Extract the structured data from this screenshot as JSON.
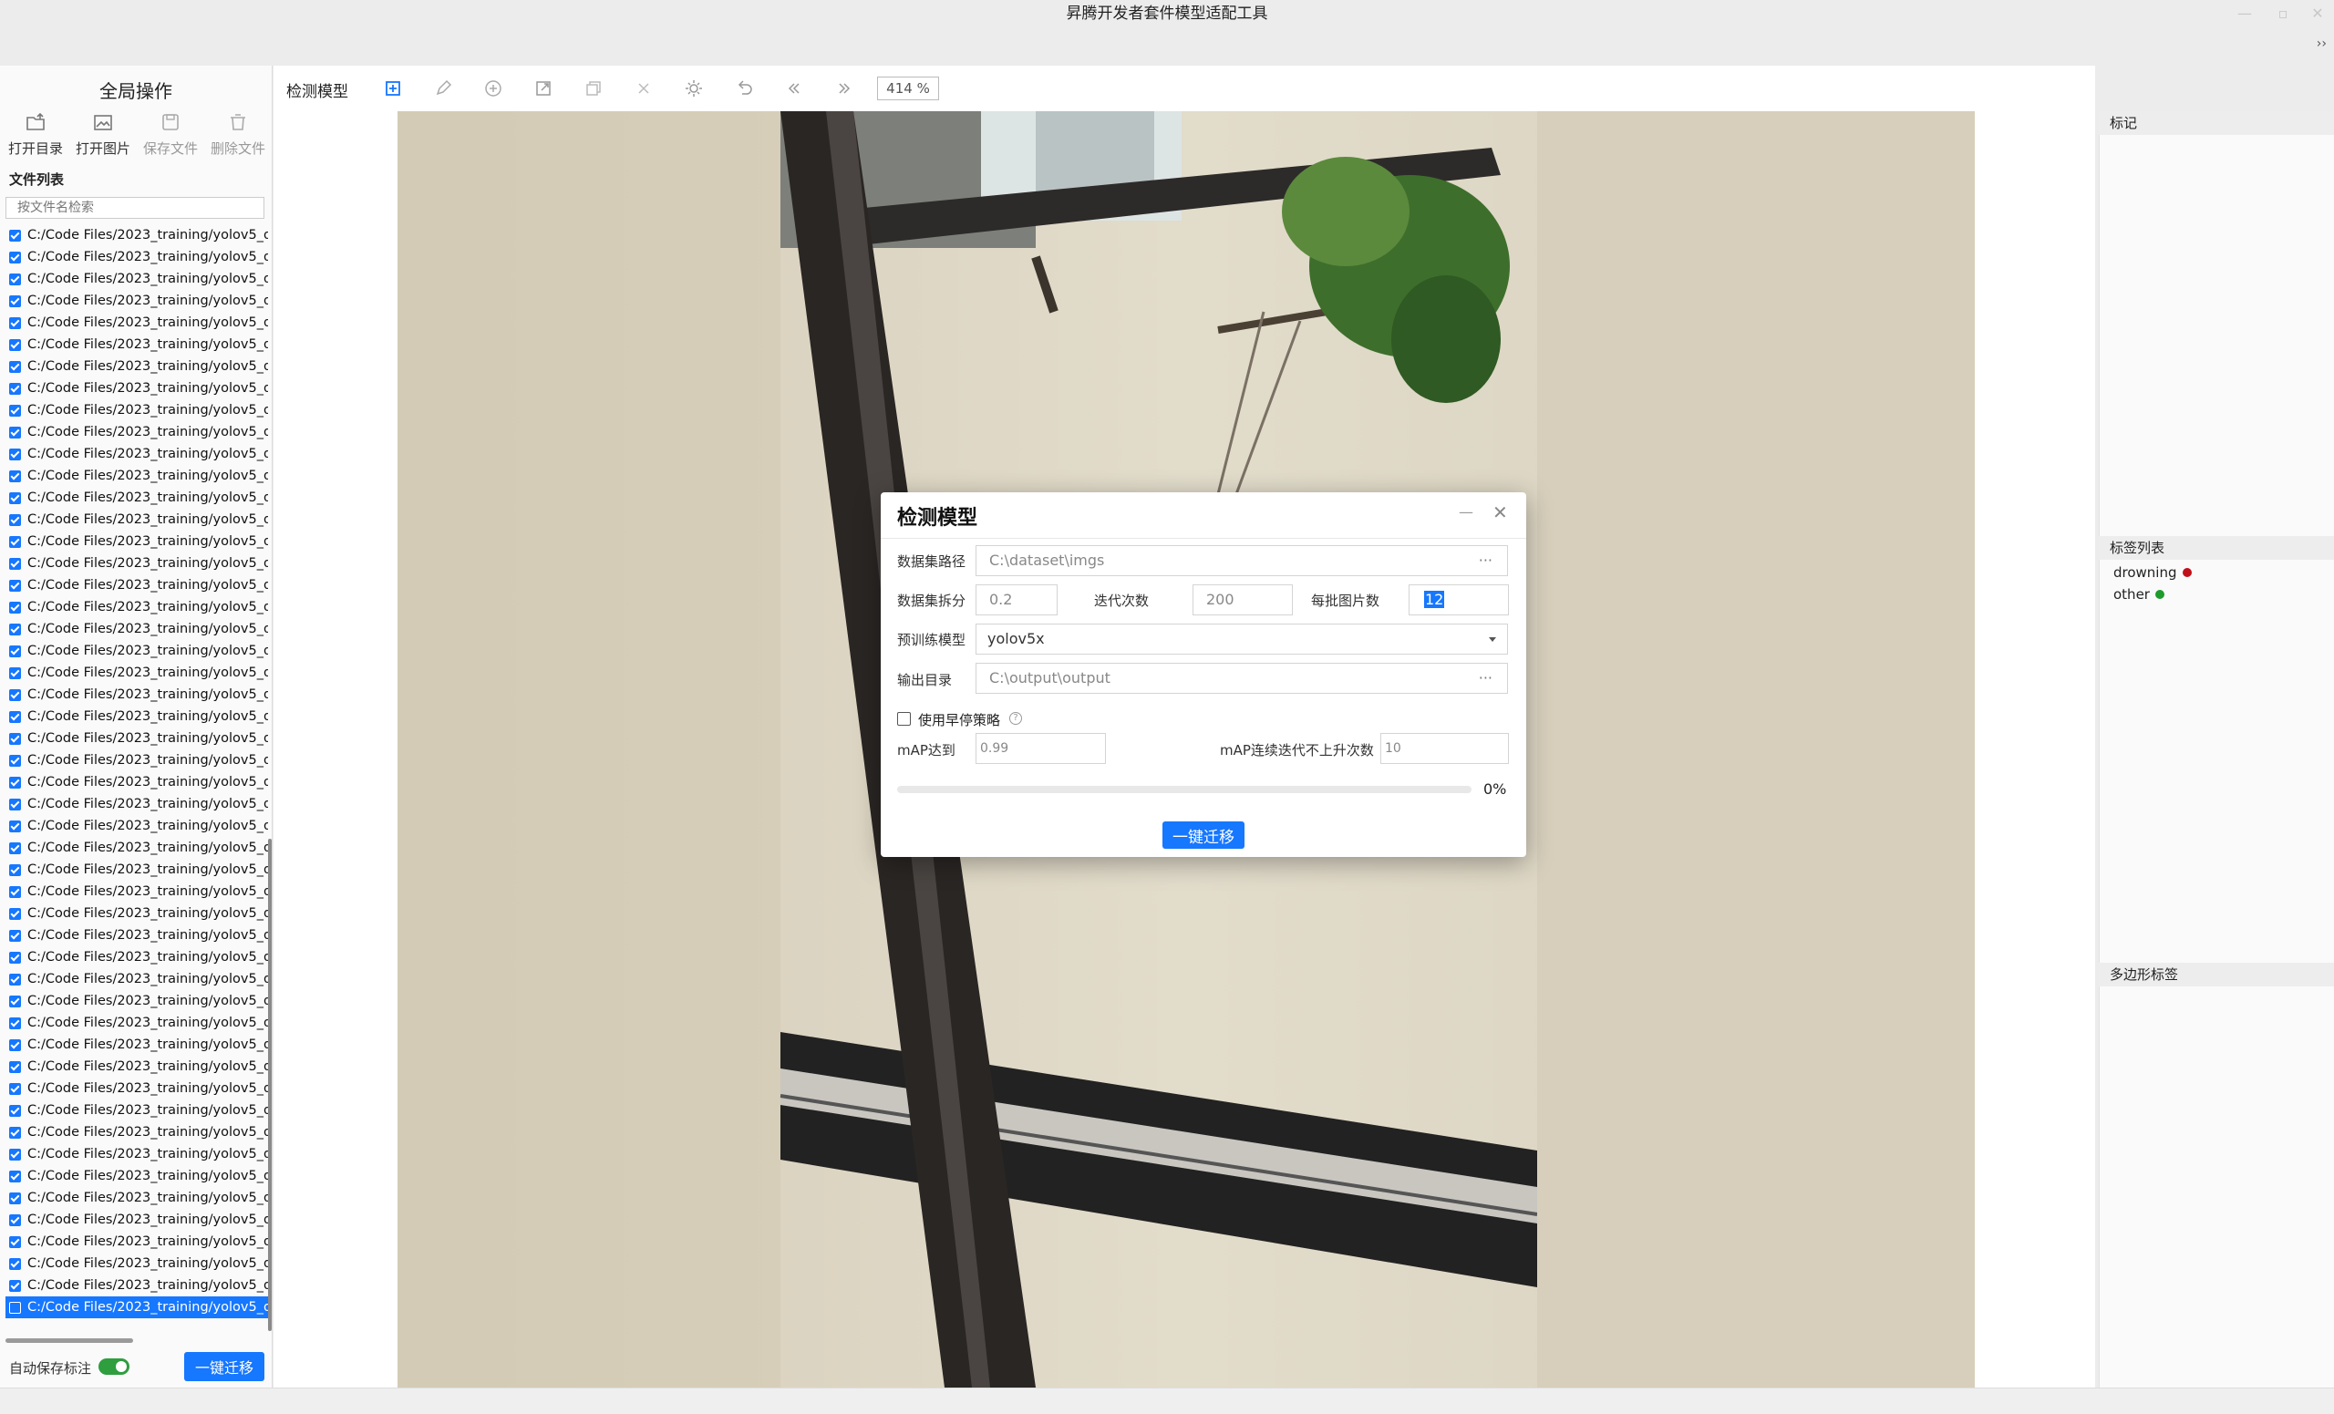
{
  "app": {
    "title": "昇腾开发者套件模型适配工具"
  },
  "left": {
    "global_ops": "全局操作",
    "tools": [
      {
        "label": "打开目录",
        "icon": "open-folder-icon"
      },
      {
        "label": "打开图片",
        "icon": "open-image-icon"
      },
      {
        "label": "保存文件",
        "icon": "save-file-icon"
      },
      {
        "label": "删除文件",
        "icon": "delete-file-icon"
      }
    ],
    "file_list_label": "文件列表",
    "search_placeholder": "按文件名检索",
    "file_item": "C:/Code Files/2023_training/yolov5_d",
    "file_count": 50,
    "selected_index": 49,
    "autosave_label": "自动保存标注",
    "autosave_on": true,
    "migrate_button": "一键迁移"
  },
  "toolbar": {
    "mode": "检测模型",
    "zoom": "414 %",
    "icons": [
      "create-rect-icon",
      "edit-pen-icon",
      "add-point-icon",
      "export-icon",
      "copy-icon",
      "delete-x-icon",
      "brightness-icon",
      "undo-icon",
      "prev-image-icon",
      "next-image-icon"
    ]
  },
  "right": {
    "marks_title": "标记",
    "label_list_title": "标签列表",
    "labels": [
      {
        "name": "drowning",
        "color": "#c0101b"
      },
      {
        "name": "other",
        "color": "#1f9b2e"
      }
    ],
    "polygon_title": "多边形标签"
  },
  "dialog": {
    "title": "检测模型",
    "dataset_path_label": "数据集路径",
    "dataset_path": "C:\\dataset\\imgs",
    "split_label": "数据集拆分",
    "split_value": "0.2",
    "iterations_label": "迭代次数",
    "iterations_value": "200",
    "batch_label": "每批图片数",
    "batch_value": "12",
    "pretrained_label": "预训练模型",
    "pretrained_value": "yolov5x",
    "output_label": "输出目录",
    "output_value": "C:\\output\\output",
    "early_stop_label": "使用早停策略",
    "early_stop_checked": false,
    "map_reach_label": "mAP达到",
    "map_reach_value": "0.99",
    "map_noimp_label": "mAP连续迭代不上升次数",
    "map_noimp_value": "10",
    "progress": 0,
    "progress_text": "0%",
    "migrate_button": "一键迁移"
  }
}
